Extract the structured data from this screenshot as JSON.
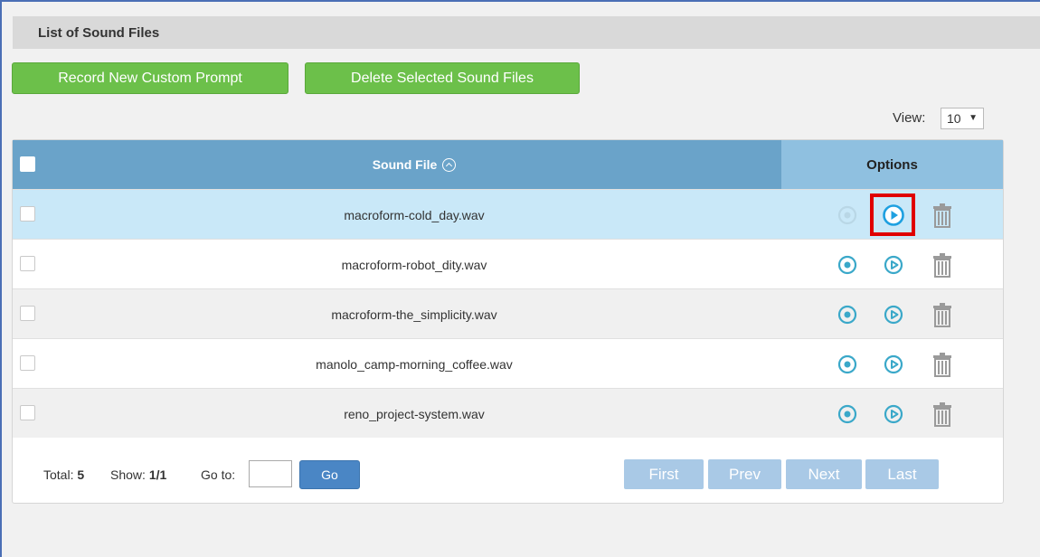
{
  "section": {
    "title": "List of Sound Files"
  },
  "toolbar": {
    "record_label": "Record New Custom Prompt",
    "delete_label": "Delete Selected Sound Files"
  },
  "view": {
    "label": "View:",
    "selected": "10"
  },
  "table": {
    "col_sound_file": "Sound File",
    "col_options": "Options",
    "rows": [
      {
        "name": "macroform-cold_day.wav",
        "selected": true
      },
      {
        "name": "macroform-robot_dity.wav",
        "selected": false
      },
      {
        "name": "macroform-the_simplicity.wav",
        "selected": false
      },
      {
        "name": "manolo_camp-morning_coffee.wav",
        "selected": false
      },
      {
        "name": "reno_project-system.wav",
        "selected": false
      }
    ]
  },
  "pager": {
    "total_label": "Total:",
    "total_value": "5",
    "show_label": "Show:",
    "show_value": "1/1",
    "goto_label": "Go to:",
    "go_label": "Go",
    "first_label": "First",
    "prev_label": "Prev",
    "next_label": "Next",
    "last_label": "Last"
  },
  "icons": {
    "record": "record-icon",
    "play": "play-icon",
    "delete": "trash-icon",
    "sort": "sort-ascending-icon"
  },
  "colors": {
    "accent_green": "#6cc04a",
    "header_blue": "#6aa3c9",
    "options_blue": "#8fc0e0",
    "selected_row": "#c9e8f8",
    "icon_teal": "#3aa8c9",
    "highlight_red": "#e00000"
  }
}
